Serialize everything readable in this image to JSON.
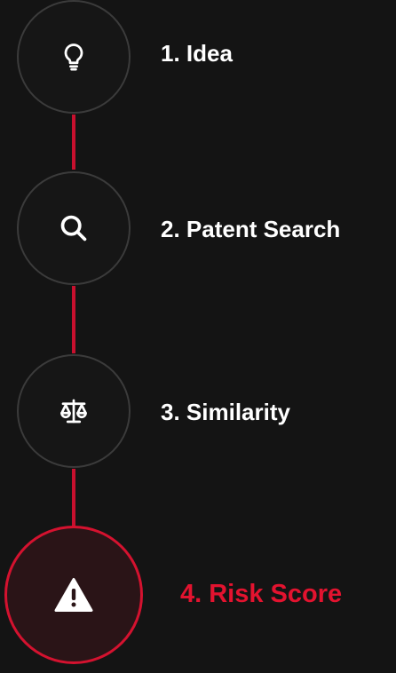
{
  "steps": [
    {
      "label": "1. Idea",
      "icon": "lightbulb-icon",
      "state": "complete"
    },
    {
      "label": "2. Patent Search",
      "icon": "search-icon",
      "state": "complete"
    },
    {
      "label": "3. Similarity",
      "icon": "scale-icon",
      "state": "complete"
    },
    {
      "label": "4. Risk Score",
      "icon": "warning-icon",
      "state": "active"
    }
  ],
  "colors": {
    "background": "#141414",
    "accent": "#d4122f",
    "connector": "#c8102e",
    "node_border": "#3b3b3b",
    "text": "#ffffff"
  }
}
